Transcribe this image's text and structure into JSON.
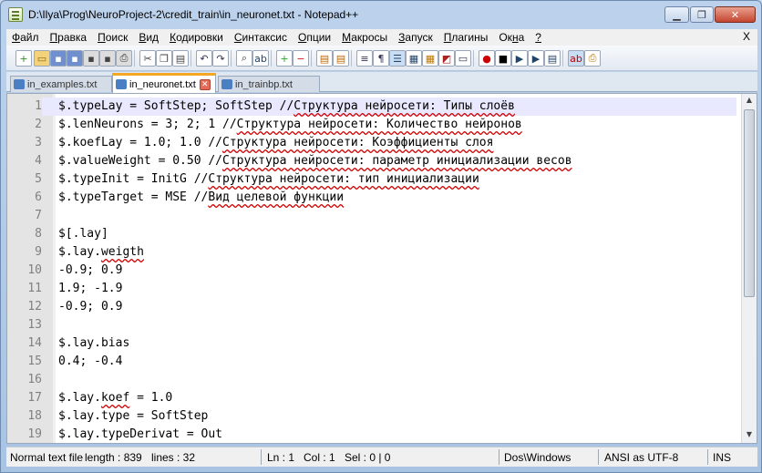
{
  "window": {
    "title": "D:\\Ilya\\Prog\\NeuroProject-2\\credit_train\\in_neuronet.txt - Notepad++"
  },
  "menu": [
    {
      "pre": "",
      "key": "Ф",
      "post": "айл"
    },
    {
      "pre": "",
      "key": "П",
      "post": "равка"
    },
    {
      "pre": "",
      "key": "П",
      "post": "оиск"
    },
    {
      "pre": "",
      "key": "В",
      "post": "ид"
    },
    {
      "pre": "",
      "key": "К",
      "post": "одировки"
    },
    {
      "pre": "",
      "key": "С",
      "post": "интаксис"
    },
    {
      "pre": "",
      "key": "О",
      "post": "пции"
    },
    {
      "pre": "",
      "key": "М",
      "post": "акросы"
    },
    {
      "pre": "",
      "key": "З",
      "post": "апуск"
    },
    {
      "pre": "",
      "key": "П",
      "post": "лагины"
    },
    {
      "pre": "Ок",
      "key": "н",
      "post": "а"
    },
    {
      "pre": "",
      "key": "?",
      "post": ""
    }
  ],
  "menu_close": "X",
  "tabs": [
    {
      "label": "in_examples.txt",
      "active": false
    },
    {
      "label": "in_neuronet.txt",
      "active": true
    },
    {
      "label": "in_trainbp.txt",
      "active": false
    }
  ],
  "editor": {
    "lines": [
      {
        "n": "1",
        "segs": [
          {
            "t": "$.typeLay = SoftStep; SoftStep //"
          },
          {
            "t": "Структура нейросети: Типы слоёв",
            "ru": true
          }
        ]
      },
      {
        "n": "2",
        "segs": [
          {
            "t": "$.lenNeurons = 3; 2; 1 //"
          },
          {
            "t": "Структура нейросети: Количество нейронов",
            "ru": true
          }
        ]
      },
      {
        "n": "3",
        "segs": [
          {
            "t": "$.koefLay = 1.0; 1.0 //"
          },
          {
            "t": "Структура нейросети: Коэффициенты слоя",
            "ru": true
          }
        ]
      },
      {
        "n": "4",
        "segs": [
          {
            "t": "$.valueWeight = 0.50 //"
          },
          {
            "t": "Структура нейросети: параметр инициализации весов",
            "ru": true
          }
        ]
      },
      {
        "n": "5",
        "segs": [
          {
            "t": "$.typeInit = InitG //"
          },
          {
            "t": "Структура нейросети: тип инициализации",
            "ru": true
          }
        ]
      },
      {
        "n": "6",
        "segs": [
          {
            "t": "$.typeTarget = MSE //"
          },
          {
            "t": "Вид целевой функции",
            "ru": true
          }
        ]
      },
      {
        "n": "7",
        "segs": []
      },
      {
        "n": "8",
        "segs": [
          {
            "t": "$[.lay]"
          }
        ]
      },
      {
        "n": "9",
        "segs": [
          {
            "t": "$.lay."
          },
          {
            "t": "weigth",
            "ru": true
          }
        ]
      },
      {
        "n": "10",
        "segs": [
          {
            "t": "-0.9; 0.9"
          }
        ]
      },
      {
        "n": "11",
        "segs": [
          {
            "t": "1.9; -1.9"
          }
        ]
      },
      {
        "n": "12",
        "segs": [
          {
            "t": "-0.9; 0.9"
          }
        ]
      },
      {
        "n": "13",
        "segs": []
      },
      {
        "n": "14",
        "segs": [
          {
            "t": "$.lay.bias"
          }
        ]
      },
      {
        "n": "15",
        "segs": [
          {
            "t": "0.4; -0.4"
          }
        ]
      },
      {
        "n": "16",
        "segs": []
      },
      {
        "n": "17",
        "segs": [
          {
            "t": "$.lay."
          },
          {
            "t": "koef",
            "ru": true
          },
          {
            "t": " = 1.0"
          }
        ]
      },
      {
        "n": "18",
        "segs": [
          {
            "t": "$.lay.type = SoftStep"
          }
        ]
      },
      {
        "n": "19",
        "segs": [
          {
            "t": "$.lay.typeDerivat = Out"
          }
        ]
      }
    ],
    "current_line": "1"
  },
  "status": {
    "type": "Normal text file",
    "length": "length : 839",
    "lines": "lines : 32",
    "ln": "Ln : 1",
    "col": "Col : 1",
    "sel": "Sel : 0 | 0",
    "eol": "Dos\\Windows",
    "encoding": "ANSI as UTF-8",
    "mode": "INS"
  },
  "toolbar_icons": [
    "new-file-icon",
    "open-file-icon",
    "save-icon",
    "save-all-icon",
    "close-icon",
    "close-all-icon",
    "print-icon",
    "cut-icon",
    "copy-icon",
    "paste-icon",
    "undo-icon",
    "redo-icon",
    "find-icon",
    "replace-icon",
    "zoom-in-icon",
    "zoom-out-icon",
    "sync-v-icon",
    "sync-h-icon",
    "word-wrap-icon",
    "show-all-chars-icon",
    "indent-guide-icon",
    "doc-map-icon",
    "function-list-icon",
    "folder-as-workspace-icon",
    "monitor-icon",
    "record-macro-icon",
    "stop-macro-icon",
    "play-macro-icon",
    "run-macro-multiple-icon",
    "save-macro-icon",
    "spellcheck-icon",
    "print-now-icon"
  ]
}
